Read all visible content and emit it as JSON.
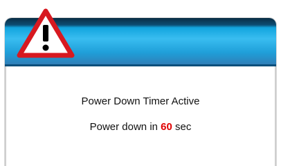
{
  "dialog": {
    "message_title": "Power Down Timer Active",
    "countdown": {
      "prefix": "Power down in",
      "value": "60",
      "unit": "sec"
    }
  },
  "icons": {
    "warning": "warning-triangle-exclamation-icon"
  },
  "colors": {
    "header_blue": "#1fa6e0",
    "countdown_red": "#e00000",
    "warning_red": "#d71920"
  }
}
